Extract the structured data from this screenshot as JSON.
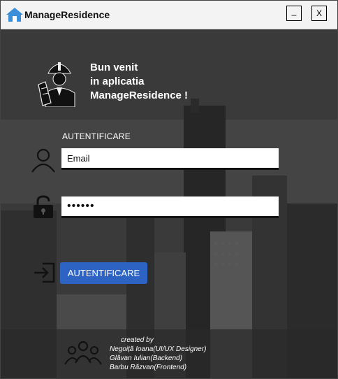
{
  "window": {
    "title": "ManageResidence",
    "minimize_label": "_",
    "close_label": "X"
  },
  "welcome": {
    "line1": "Bun venit",
    "line2": "in aplicatia",
    "line3": "ManageResidence !"
  },
  "login": {
    "section_label": "AUTENTIFICARE",
    "email_value": "Email",
    "password_value": "••••••",
    "button_label": "AUTENTIFICARE"
  },
  "credits": {
    "created_by": "created by",
    "authors": [
      "Negoiță Ioana(UI/UX Designer)",
      "Glăvan Iulian(Backend)",
      "Barbu Răzvan(Frontend)"
    ]
  },
  "colors": {
    "accent": "#2d64c4",
    "titlebar": "#f3f3f3",
    "app_icon": "#3a8fd8"
  },
  "icons": {
    "app": "house-icon",
    "welcome": "engineer-icon",
    "user": "user-icon",
    "password": "lock-icon",
    "login": "login-icon",
    "team": "team-icon"
  }
}
